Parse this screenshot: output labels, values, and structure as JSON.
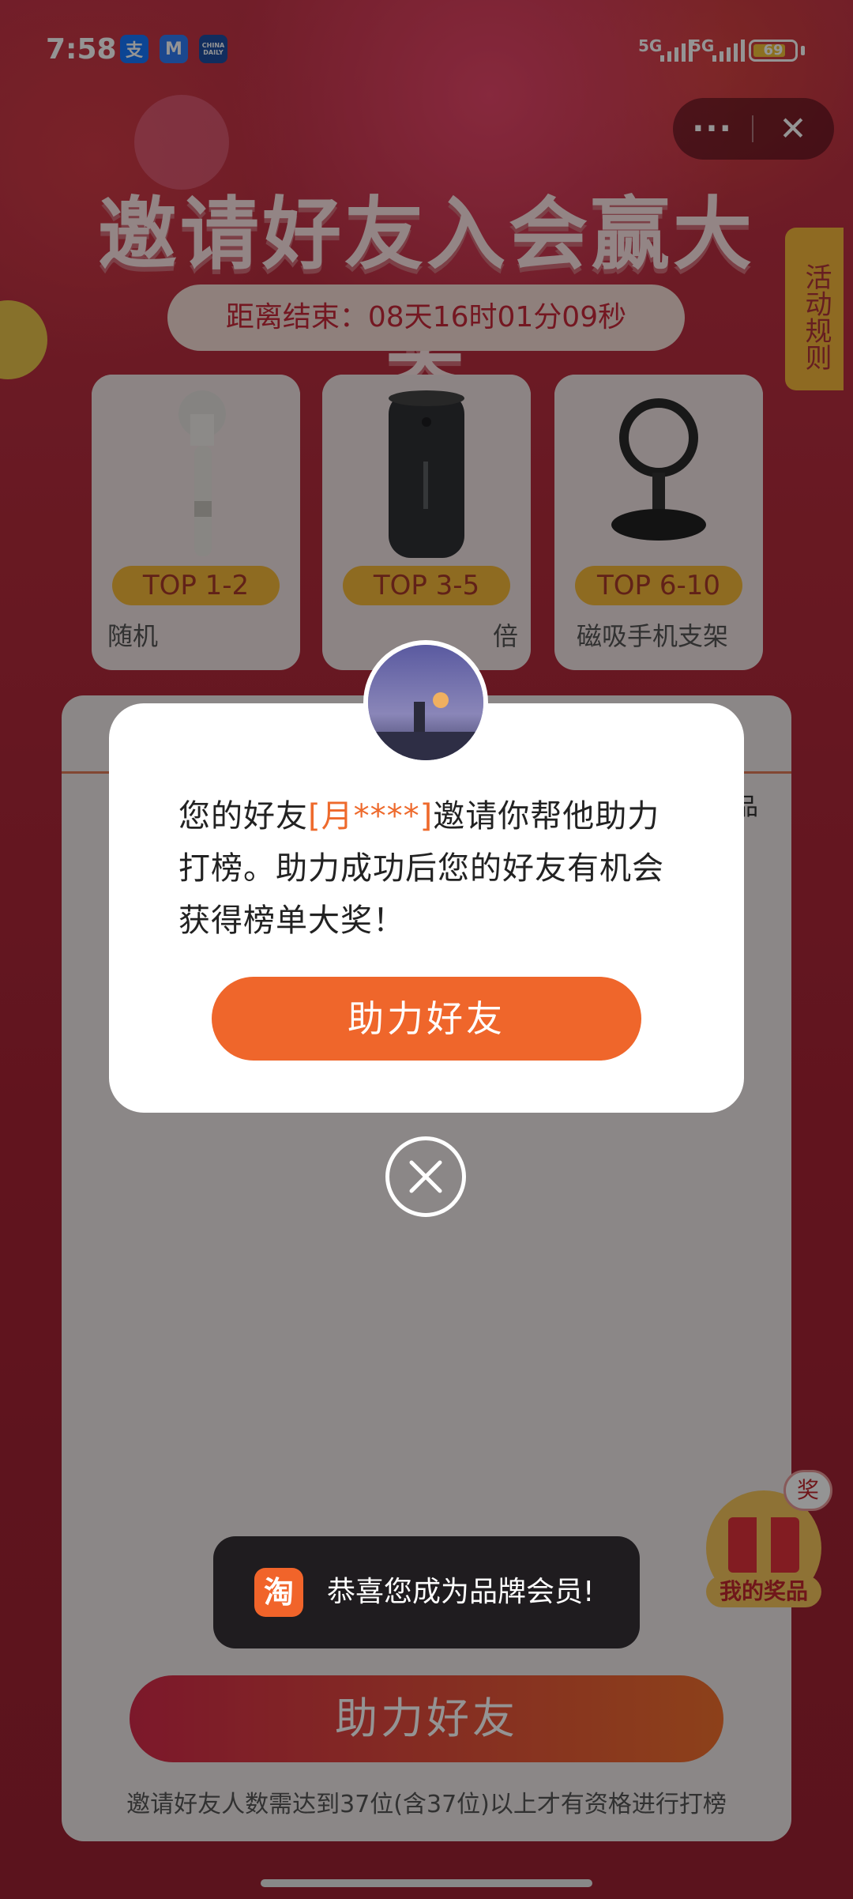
{
  "status_bar": {
    "time": "7:58",
    "apps": [
      "支",
      "M",
      "CHINA DAILY"
    ],
    "network": [
      "5G",
      "5G"
    ],
    "battery": "69"
  },
  "capsule": {
    "more": "···",
    "close": "✕"
  },
  "header": {
    "title": "邀请好友入会赢大奖",
    "countdown": "距离结束：08天16时01分09秒",
    "rules": "活动规则"
  },
  "prizes": [
    {
      "rank": "TOP 1-2",
      "name": "随机"
    },
    {
      "rank": "TOP 3-5",
      "name": "倍"
    },
    {
      "rank": "TOP 6-10",
      "name": "磁吸手机支架"
    }
  ],
  "panel": {
    "side_text": "品",
    "button": "助力好友",
    "note": "邀请好友人数需达到37位(含37位)以上才有资格进行打榜"
  },
  "my_prize": {
    "label": "我的奖品",
    "badge": "奖"
  },
  "modal": {
    "text_before": "您的好友",
    "friend_name": "[月****]",
    "text_after": "邀请你帮他助力打榜。助力成功后您的好友有机会获得榜单大奖！",
    "button": "助力好友"
  },
  "toast": {
    "icon": "淘",
    "text": "恭喜您成为品牌会员!"
  },
  "colors": {
    "accent": "#ef662b",
    "brand_red": "#c8283a",
    "gold": "#f5b83a"
  }
}
